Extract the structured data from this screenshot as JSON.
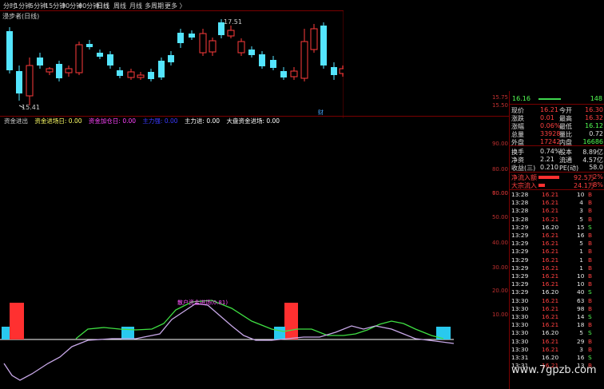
{
  "toolbar": {
    "items": [
      "分时",
      "1分钟",
      "5分钟",
      "15分钟",
      "30分钟",
      "60分钟",
      "日线",
      "周线",
      "月线",
      "多周期",
      "更多 〉"
    ],
    "active_index": 6
  },
  "chart": {
    "title": "浸步者(日线)",
    "high_label": "17.51",
    "low_label": "15.41",
    "marker_label": "财",
    "price_labels": [
      "15.75",
      "15.50"
    ],
    "colors": {
      "up": "#ff3b3b",
      "down": "#54e5ff",
      "bg": "#000000"
    }
  },
  "indicator": {
    "legend": [
      {
        "text": "资金进出",
        "color": "#d8d8d8"
      },
      {
        "text": "资金进场日: 0.00",
        "color": "#ffff66"
      },
      {
        "text": "资金加仓日: 0.00",
        "color": "#ff44ff"
      },
      {
        "text": "主力强: 0.00",
        "color": "#3a3aff"
      },
      {
        "text": "主力进: 0.00",
        "color": "#ffffff"
      },
      {
        "text": "大盘资金进场: 0.00",
        "color": "#ffffff"
      }
    ],
    "annotation": "散户资金进场(0.81)",
    "axis_labels": [
      "90.00",
      "80.00",
      "70.00",
      "60.00",
      "50.00",
      "40.00",
      "30.00",
      "20.00",
      "10.00"
    ]
  },
  "panel": {
    "top_partial": {
      "price": "16.16",
      "volume": "148"
    },
    "quote": [
      {
        "l1": "现价",
        "v1": "16.21",
        "l2": "今开",
        "v2": "16.30"
      },
      {
        "l1": "涨跌",
        "v1": "0.01",
        "l2": "最高",
        "v2": "16.32"
      },
      {
        "l1": "涨幅",
        "v1": "0.06%",
        "l2": "最低",
        "v2": "16.12"
      },
      {
        "l1": "总量",
        "v1": "33928",
        "l2": "量比",
        "v2": "0.72"
      },
      {
        "l1": "外盘",
        "v1": "17242",
        "l2": "内盘",
        "v2": "16686"
      }
    ],
    "stats": [
      {
        "l1": "换手",
        "v1": "0.74%",
        "l2": "股本",
        "v2": "8.89亿"
      },
      {
        "l1": "净资",
        "v1": "2.21",
        "l2": "流通",
        "v2": "4.57亿"
      },
      {
        "l1": "收益(三)",
        "v1": "0.210",
        "l2": "PE(动)",
        "v2": "58.0"
      }
    ],
    "flows": [
      {
        "label": "净流入额",
        "value": "92.5万",
        "pct": "2%"
      },
      {
        "label": "大宗流入",
        "value": "24.1万",
        "pct": "8%"
      }
    ],
    "trades": [
      {
        "t": "13:28",
        "p": "16.21",
        "v": "10",
        "s": "B"
      },
      {
        "t": "13:28",
        "p": "16.21",
        "v": "4",
        "s": "B"
      },
      {
        "t": "13:28",
        "p": "16.21",
        "v": "3",
        "s": "B"
      },
      {
        "t": "13:28",
        "p": "16.21",
        "v": "5",
        "s": "B"
      },
      {
        "t": "13:29",
        "p": "16.20",
        "v": "15",
        "s": "S"
      },
      {
        "t": "13:29",
        "p": "16.21",
        "v": "16",
        "s": "B"
      },
      {
        "t": "13:29",
        "p": "16.21",
        "v": "5",
        "s": "B"
      },
      {
        "t": "13:29",
        "p": "16.21",
        "v": "1",
        "s": "B"
      },
      {
        "t": "13:29",
        "p": "16.21",
        "v": "1",
        "s": "B"
      },
      {
        "t": "13:29",
        "p": "16.21",
        "v": "1",
        "s": "B"
      },
      {
        "t": "13:29",
        "p": "16.21",
        "v": "10",
        "s": "B"
      },
      {
        "t": "13:29",
        "p": "16.21",
        "v": "10",
        "s": "B"
      },
      {
        "t": "13:29",
        "p": "16.20",
        "v": "40",
        "s": "S"
      },
      {
        "t": "13:30",
        "p": "16.21",
        "v": "63",
        "s": "B"
      },
      {
        "t": "13:30",
        "p": "16.21",
        "v": "98",
        "s": "B"
      },
      {
        "t": "13:30",
        "p": "16.21",
        "v": "14",
        "s": "S"
      },
      {
        "t": "13:30",
        "p": "16.21",
        "v": "18",
        "s": "B"
      },
      {
        "t": "13:30",
        "p": "16.20",
        "v": "5",
        "s": "S"
      },
      {
        "t": "13:30",
        "p": "16.21",
        "v": "29",
        "s": "B"
      },
      {
        "t": "13:30",
        "p": "16.21",
        "v": "3",
        "s": "B"
      },
      {
        "t": "13:31",
        "p": "16.20",
        "v": "16",
        "s": "S"
      },
      {
        "t": "13:31",
        "p": "16.21",
        "v": "13",
        "s": "B"
      }
    ]
  },
  "watermark": "www.7gpzb.com"
}
